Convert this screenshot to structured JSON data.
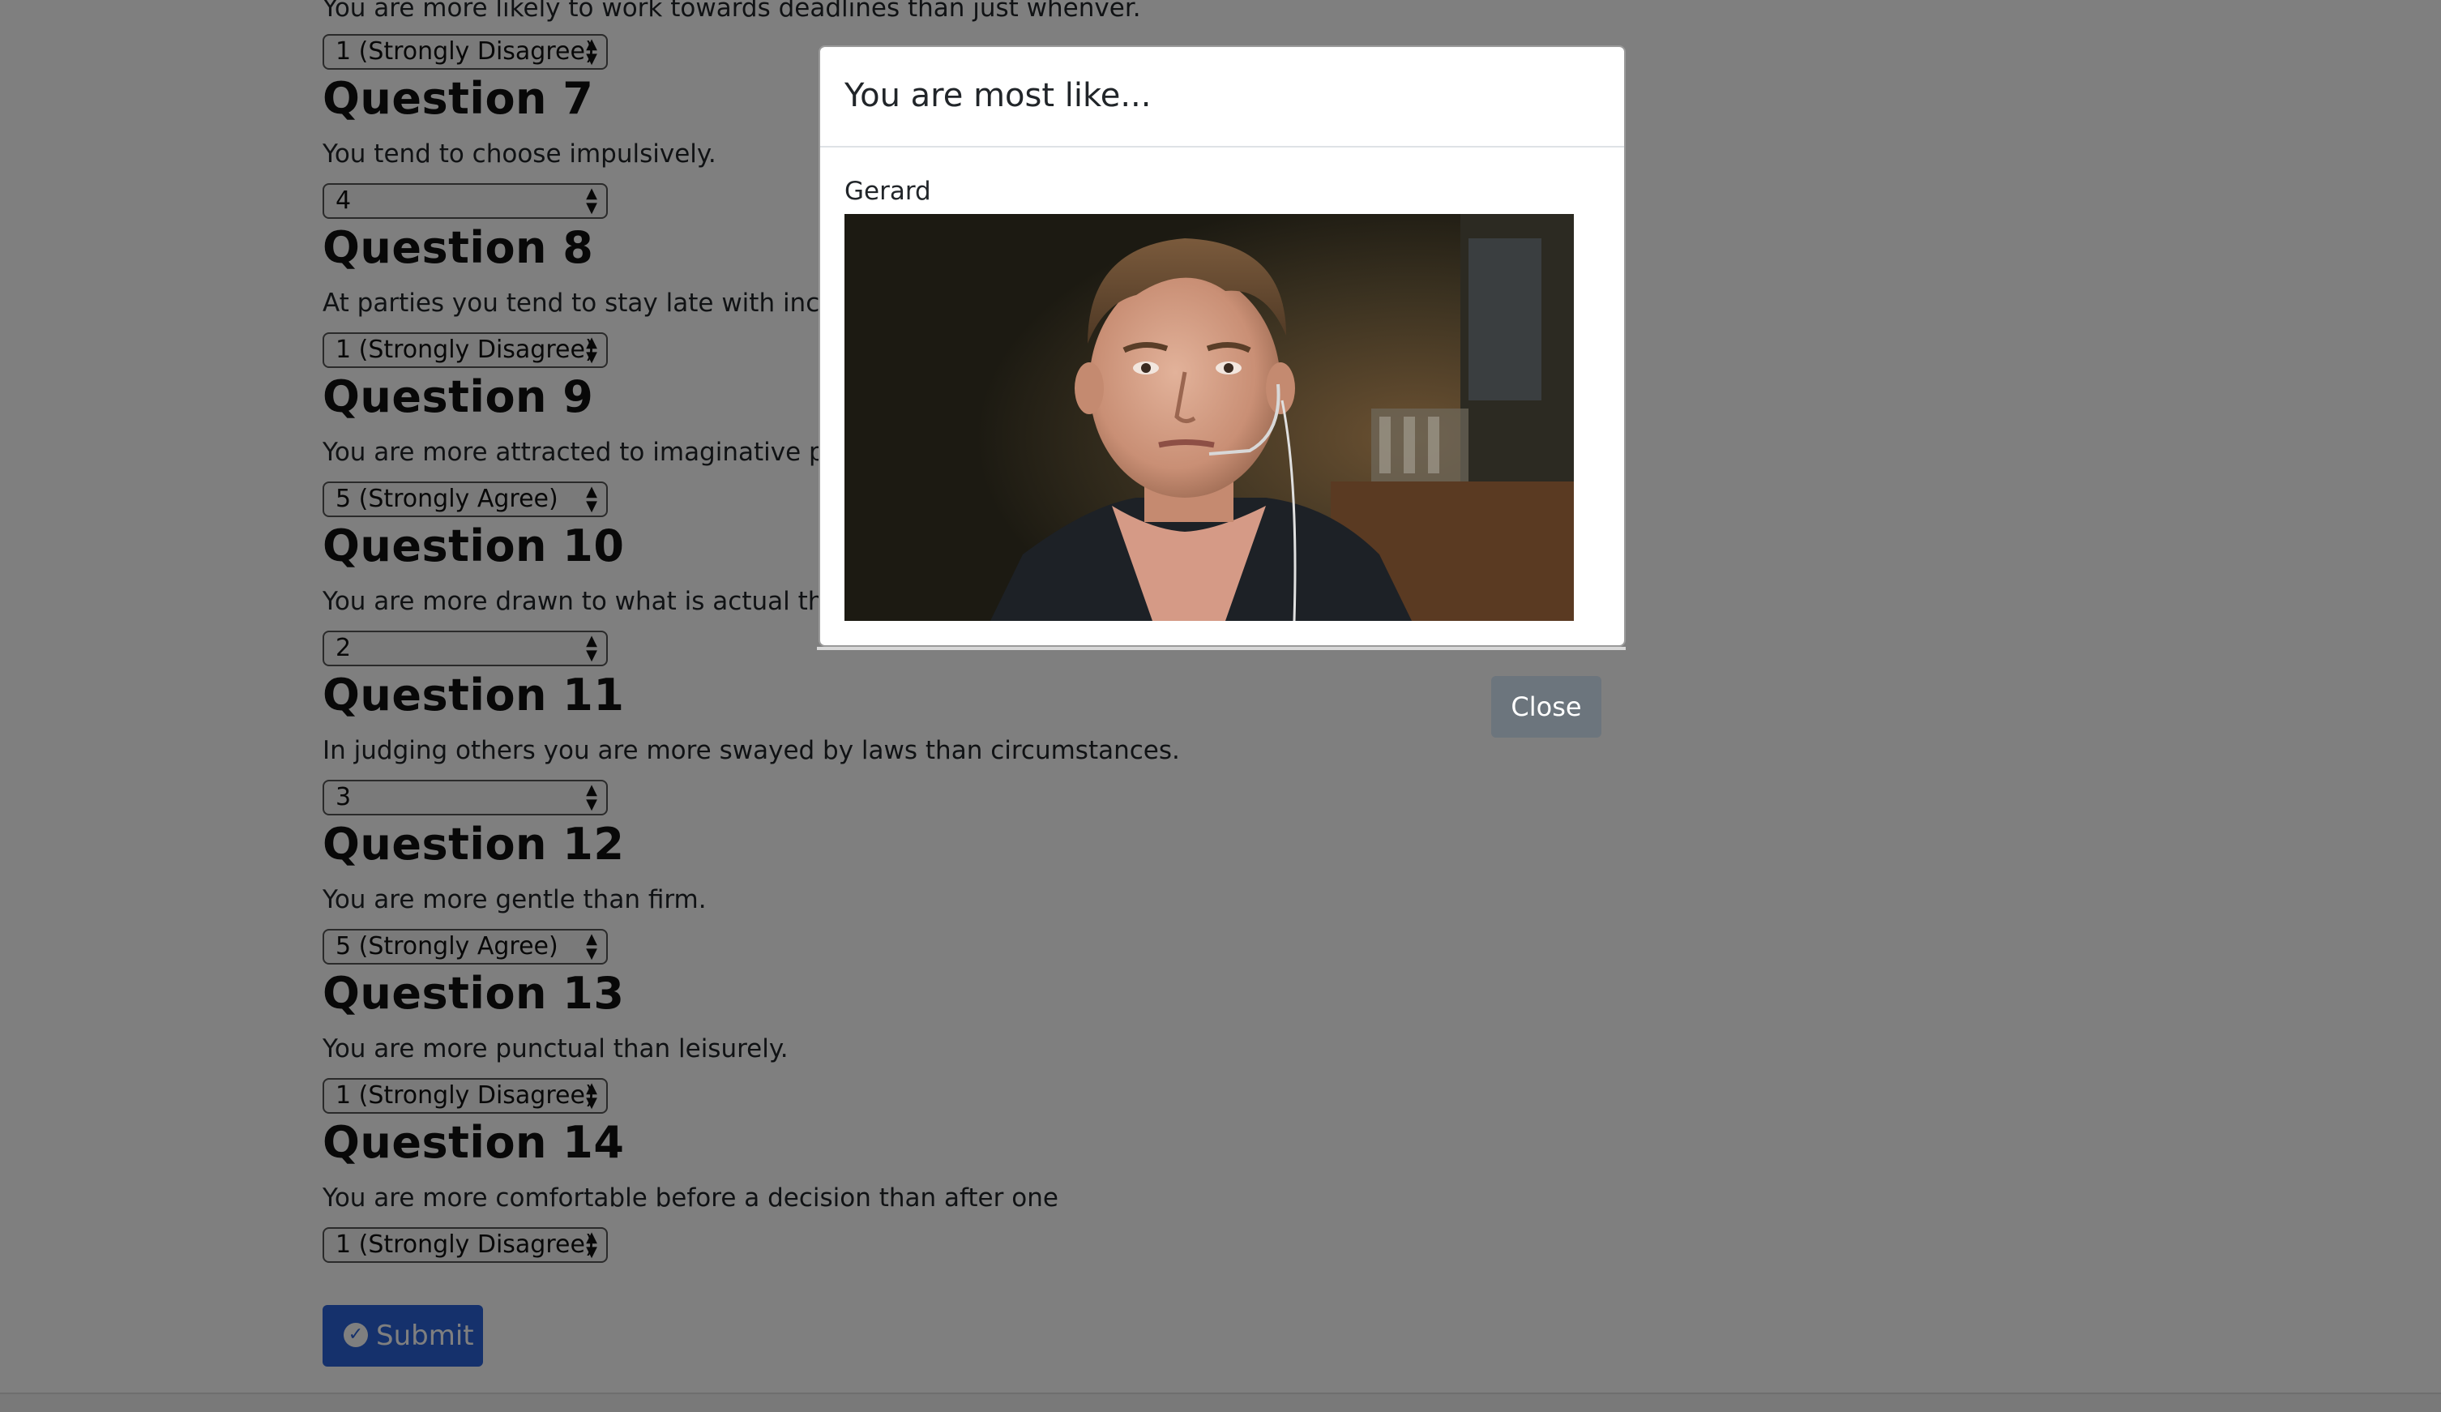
{
  "quiz": {
    "partial_question_text": "You are more likely to work towards deadlines than just whenver.",
    "partial_select_value": "1 (Strongly Disagree)",
    "questions": [
      {
        "title": "Question 7",
        "text": "You tend to choose impulsively.",
        "answer": "4"
      },
      {
        "title": "Question 8",
        "text": "At parties you tend to stay late with increa",
        "answer": "1 (Strongly Disagree)"
      },
      {
        "title": "Question 9",
        "text": "You are more attracted to imaginative peo",
        "answer": "5 (Strongly Agree)"
      },
      {
        "title": "Question 10",
        "text": "You are more drawn to what is actual than",
        "answer": "2"
      },
      {
        "title": "Question 11",
        "text": "In judging others you are more swayed by laws than circumstances.",
        "answer": "3"
      },
      {
        "title": "Question 12",
        "text": "You are more gentle than firm.",
        "answer": "5 (Strongly Agree)"
      },
      {
        "title": "Question 13",
        "text": "You are more punctual than leisurely.",
        "answer": "1 (Strongly Disagree)"
      },
      {
        "title": "Question 14",
        "text": "You are more comfortable before a decision than after one",
        "answer": "1 (Strongly Disagree)"
      }
    ],
    "submit_label": "Submit",
    "submit_icon": "check-circle-icon"
  },
  "modal": {
    "title": "You are most like...",
    "result_name": "Gerard",
    "result_image_alt": "Gerard",
    "close_label": "Close"
  },
  "colors": {
    "backdrop": "#000000",
    "submit_bg": "#2a62d8",
    "close_bg": "#6c757d"
  }
}
